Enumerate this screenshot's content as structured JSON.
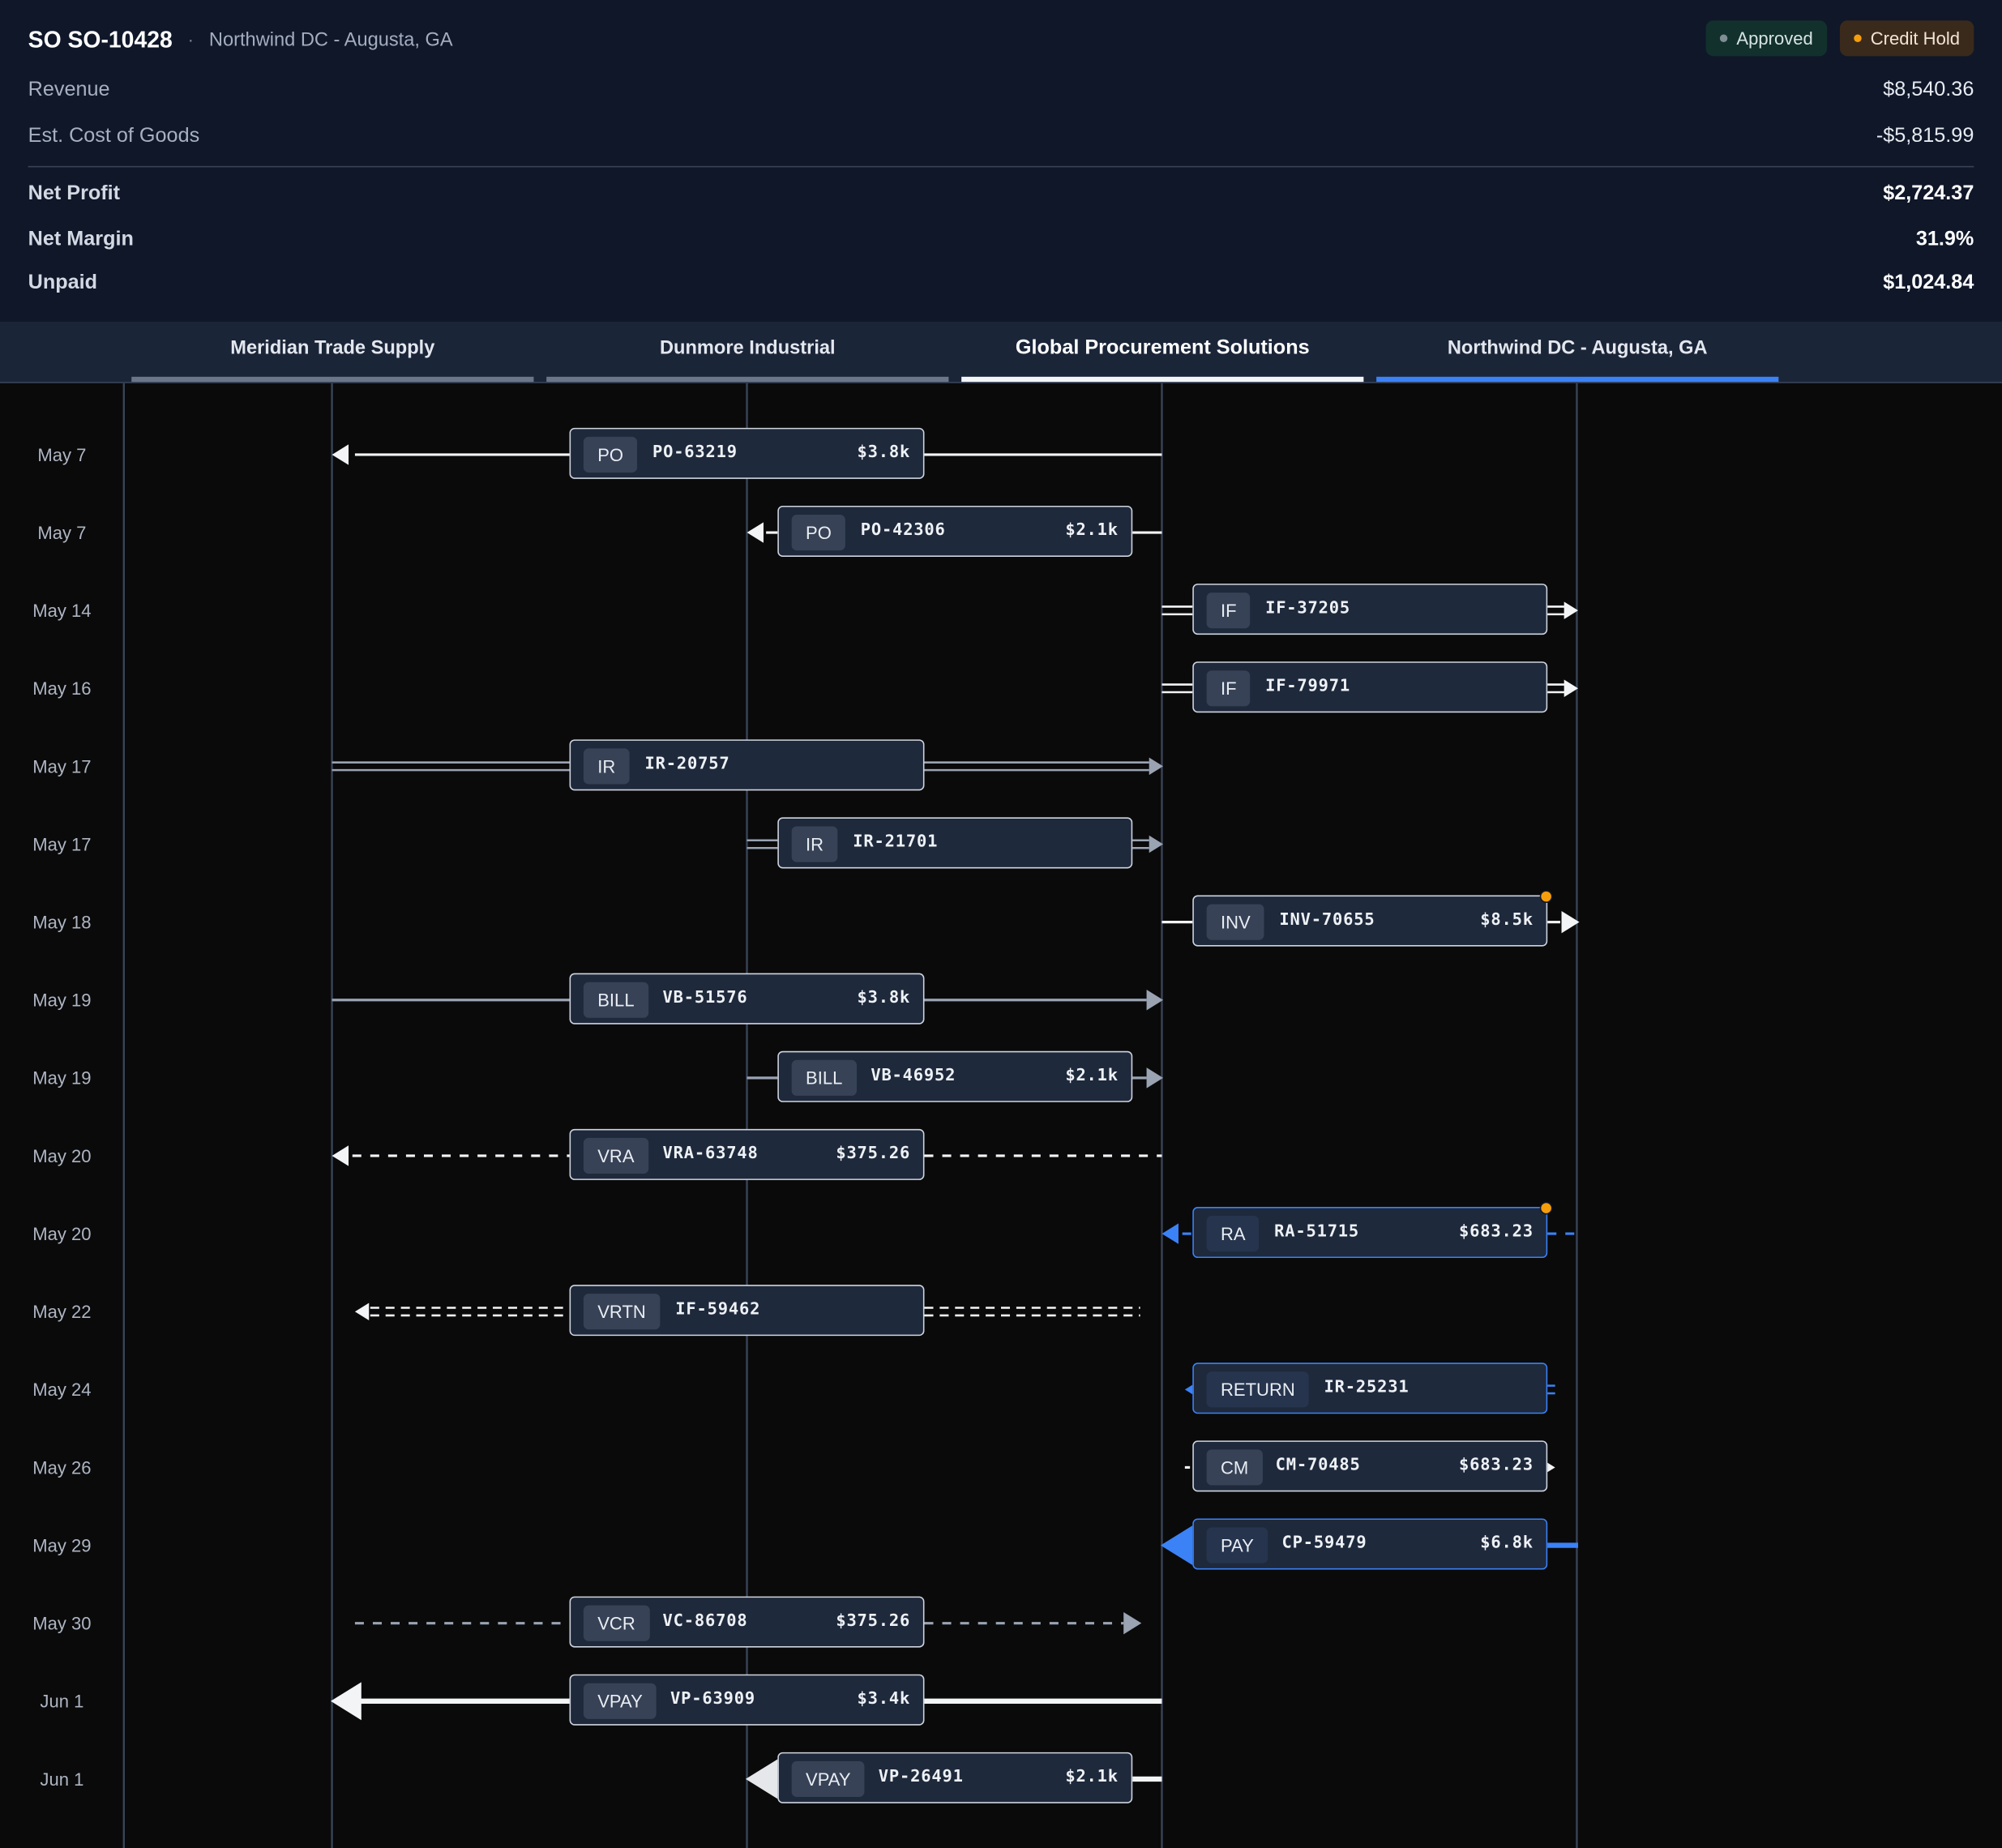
{
  "header": {
    "so_title": "SO SO-10428",
    "separator": "·",
    "subtitle": "Northwind DC - Augusta, GA",
    "badges": [
      {
        "label": "Approved",
        "color": "#7f8e94"
      },
      {
        "label": "Credit Hold",
        "color": "#f59e0b"
      }
    ]
  },
  "financials": {
    "revenue_label": "Revenue",
    "revenue_value": "$8,540.36",
    "cogs_label": "Est. Cost of Goods",
    "cogs_value": "-$5,815.99",
    "net_profit_label": "Net Profit",
    "net_profit_value": "$2,724.37",
    "net_margin_label": "Net Margin",
    "net_margin_value": "31.9%",
    "unpaid_label": "Unpaid",
    "unpaid_value": "$1,024.84"
  },
  "tabs": [
    {
      "label": "Meridian Trade Supply"
    },
    {
      "label": "Dunmore Industrial"
    },
    {
      "label": "Global Procurement Solutions"
    },
    {
      "label": "Northwind DC - Augusta, GA"
    }
  ],
  "colors": {
    "accent_blue": "#3b82f6",
    "warning": "#f59e0b",
    "card_bg": "#1e293b",
    "page_bg": "#0a0a0b",
    "header_bg": "#0f1729"
  },
  "events": [
    {
      "date": "May 7",
      "type": "PO",
      "id": "PO-63219",
      "amount": "$3.8k"
    },
    {
      "date": "May 7",
      "type": "PO",
      "id": "PO-42306",
      "amount": "$2.1k"
    },
    {
      "date": "May 14",
      "type": "IF",
      "id": "IF-37205",
      "amount": ""
    },
    {
      "date": "May 16",
      "type": "IF",
      "id": "IF-79971",
      "amount": ""
    },
    {
      "date": "May 17",
      "type": "IR",
      "id": "IR-20757",
      "amount": ""
    },
    {
      "date": "May 17",
      "type": "IR",
      "id": "IR-21701",
      "amount": ""
    },
    {
      "date": "May 18",
      "type": "INV",
      "id": "INV-70655",
      "amount": "$8.5k"
    },
    {
      "date": "May 19",
      "type": "BILL",
      "id": "VB-51576",
      "amount": "$3.8k"
    },
    {
      "date": "May 19",
      "type": "BILL",
      "id": "VB-46952",
      "amount": "$2.1k"
    },
    {
      "date": "May 20",
      "type": "VRA",
      "id": "VRA-63748",
      "amount": "$375.26"
    },
    {
      "date": "May 20",
      "type": "RA",
      "id": "RA-51715",
      "amount": "$683.23"
    },
    {
      "date": "May 22",
      "type": "VRTN",
      "id": "IF-59462",
      "amount": ""
    },
    {
      "date": "May 24",
      "type": "RETURN",
      "id": "IR-25231",
      "amount": ""
    },
    {
      "date": "May 26",
      "type": "CM",
      "id": "CM-70485",
      "amount": "$683.23"
    },
    {
      "date": "May 29",
      "type": "PAY",
      "id": "CP-59479",
      "amount": "$6.8k"
    },
    {
      "date": "May 30",
      "type": "VCR",
      "id": "VC-86708",
      "amount": "$375.26"
    },
    {
      "date": "Jun 1",
      "type": "VPAY",
      "id": "VP-63909",
      "amount": "$3.4k"
    },
    {
      "date": "Jun 1",
      "type": "VPAY",
      "id": "VP-26491",
      "amount": "$2.1k"
    }
  ]
}
